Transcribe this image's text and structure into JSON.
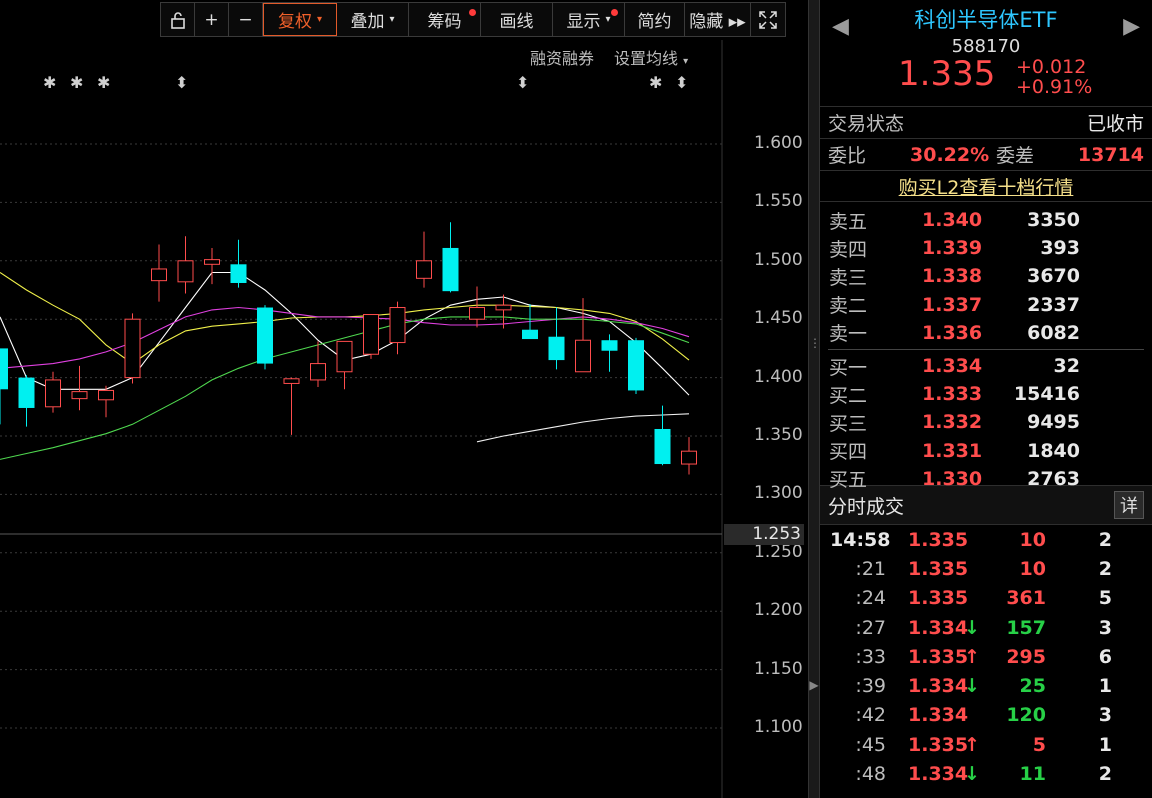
{
  "toolbar": {
    "items": [
      {
        "id": "lock",
        "label": "",
        "icon": "lock-icon"
      },
      {
        "id": "plus",
        "label": "+",
        "icon": "plus-icon"
      },
      {
        "id": "minus",
        "label": "−",
        "icon": "minus-icon"
      },
      {
        "id": "fuquan",
        "label": "复权",
        "active": true,
        "caret": true
      },
      {
        "id": "diejia",
        "label": "叠加",
        "caret": true
      },
      {
        "id": "chouma",
        "label": "筹码",
        "dot": true
      },
      {
        "id": "huaxian",
        "label": "画线"
      },
      {
        "id": "xianshi",
        "label": "显示",
        "caret": true,
        "dot": true
      },
      {
        "id": "jianyue",
        "label": "简约"
      },
      {
        "id": "yincang",
        "label": "隐藏 ▸▸"
      },
      {
        "id": "fullscreen",
        "label": "",
        "icon": "fullscreen-icon"
      }
    ]
  },
  "sub_tools": {
    "margin_label": "融资融券",
    "ma_label": "设置均线"
  },
  "markers": [
    "✱",
    "✱",
    "✱",
    "⬍",
    "⬍",
    "✱",
    "⬍"
  ],
  "chart_data": {
    "type": "candlestick",
    "y_ticks": [
      "1.600",
      "1.550",
      "1.500",
      "1.450",
      "1.400",
      "1.350",
      "1.300",
      "1.250",
      "1.200",
      "1.150",
      "1.100"
    ],
    "ylim": [
      1.08,
      1.64
    ],
    "current_price_tag": "1.253",
    "candles": [
      {
        "o": 1.39,
        "h": 1.395,
        "l": 1.36,
        "c": 1.425,
        "dir": "down"
      },
      {
        "o": 1.4,
        "h": 1.402,
        "l": 1.358,
        "c": 1.374,
        "dir": "down"
      },
      {
        "o": 1.375,
        "h": 1.405,
        "l": 1.37,
        "c": 1.398,
        "dir": "up"
      },
      {
        "o": 1.382,
        "h": 1.41,
        "l": 1.372,
        "c": 1.388,
        "dir": "up"
      },
      {
        "o": 1.381,
        "h": 1.393,
        "l": 1.366,
        "c": 1.389,
        "dir": "up"
      },
      {
        "o": 1.4,
        "h": 1.455,
        "l": 1.395,
        "c": 1.45,
        "dir": "up"
      },
      {
        "o": 1.483,
        "h": 1.514,
        "l": 1.465,
        "c": 1.493,
        "dir": "up"
      },
      {
        "o": 1.482,
        "h": 1.521,
        "l": 1.472,
        "c": 1.5,
        "dir": "up"
      },
      {
        "o": 1.497,
        "h": 1.511,
        "l": 1.48,
        "c": 1.501,
        "dir": "up"
      },
      {
        "o": 1.497,
        "h": 1.518,
        "l": 1.477,
        "c": 1.481,
        "dir": "down"
      },
      {
        "o": 1.46,
        "h": 1.462,
        "l": 1.407,
        "c": 1.412,
        "dir": "down"
      },
      {
        "o": 1.395,
        "h": 1.4,
        "l": 1.351,
        "c": 1.399,
        "dir": "up"
      },
      {
        "o": 1.398,
        "h": 1.431,
        "l": 1.392,
        "c": 1.412,
        "dir": "up"
      },
      {
        "o": 1.405,
        "h": 1.421,
        "l": 1.39,
        "c": 1.431,
        "dir": "up"
      },
      {
        "o": 1.42,
        "h": 1.454,
        "l": 1.416,
        "c": 1.454,
        "dir": "up"
      },
      {
        "o": 1.43,
        "h": 1.465,
        "l": 1.42,
        "c": 1.46,
        "dir": "up"
      },
      {
        "o": 1.485,
        "h": 1.525,
        "l": 1.477,
        "c": 1.5,
        "dir": "up"
      },
      {
        "o": 1.511,
        "h": 1.533,
        "l": 1.473,
        "c": 1.474,
        "dir": "down"
      },
      {
        "o": 1.45,
        "h": 1.478,
        "l": 1.443,
        "c": 1.46,
        "dir": "up"
      },
      {
        "o": 1.458,
        "h": 1.471,
        "l": 1.442,
        "c": 1.462,
        "dir": "up"
      },
      {
        "o": 1.441,
        "h": 1.463,
        "l": 1.433,
        "c": 1.433,
        "dir": "down"
      },
      {
        "o": 1.435,
        "h": 1.46,
        "l": 1.407,
        "c": 1.415,
        "dir": "down"
      },
      {
        "o": 1.405,
        "h": 1.468,
        "l": 1.405,
        "c": 1.432,
        "dir": "up"
      },
      {
        "o": 1.432,
        "h": 1.437,
        "l": 1.405,
        "c": 1.423,
        "dir": "down"
      },
      {
        "o": 1.432,
        "h": 1.434,
        "l": 1.386,
        "c": 1.389,
        "dir": "down"
      },
      {
        "o": 1.356,
        "h": 1.376,
        "l": 1.325,
        "c": 1.326,
        "dir": "down"
      },
      {
        "o": 1.326,
        "h": 1.349,
        "l": 1.317,
        "c": 1.337,
        "dir": "up"
      }
    ],
    "series": [
      {
        "color": "#ffffff",
        "y": [
          1.452,
          1.4,
          1.39,
          1.39,
          1.39,
          1.4,
          1.43,
          1.46,
          1.49,
          1.49,
          1.475,
          1.455,
          1.432,
          1.415,
          1.42,
          1.432,
          1.45,
          1.462,
          1.467,
          1.469,
          1.462,
          1.46,
          1.455,
          1.448,
          1.43,
          1.408,
          1.385
        ]
      },
      {
        "color": "#f0f04a",
        "y": [
          1.49,
          1.475,
          1.462,
          1.45,
          1.428,
          1.412,
          1.428,
          1.44,
          1.444,
          1.446,
          1.448,
          1.451,
          1.452,
          1.452,
          1.453,
          1.455,
          1.458,
          1.46,
          1.462,
          1.462,
          1.461,
          1.46,
          1.458,
          1.455,
          1.448,
          1.433,
          1.415
        ]
      },
      {
        "color": "#e040e0",
        "y": [
          1.408,
          1.41,
          1.412,
          1.416,
          1.422,
          1.43,
          1.441,
          1.452,
          1.458,
          1.46,
          1.458,
          1.455,
          1.452,
          1.452,
          1.451,
          1.45,
          1.447,
          1.445,
          1.445,
          1.446,
          1.448,
          1.45,
          1.452,
          1.45,
          1.447,
          1.442,
          1.435
        ]
      },
      {
        "color": "#4fd84f",
        "y": [
          1.33,
          1.335,
          1.34,
          1.346,
          1.352,
          1.36,
          1.372,
          1.384,
          1.398,
          1.408,
          1.416,
          1.422,
          1.428,
          1.434,
          1.44,
          1.446,
          1.45,
          1.452,
          1.452,
          1.452,
          1.45,
          1.45,
          1.45,
          1.448,
          1.446,
          1.438,
          1.43
        ]
      },
      {
        "color": "#f0f0f0",
        "y": [
          null,
          null,
          null,
          null,
          null,
          null,
          null,
          null,
          null,
          null,
          null,
          null,
          null,
          null,
          null,
          null,
          null,
          null,
          1.345,
          1.35,
          1.354,
          1.358,
          1.362,
          1.365,
          1.367,
          1.368,
          1.369
        ]
      }
    ]
  },
  "quote": {
    "name": "科创半导体ETF",
    "code": "588170",
    "price": "1.335",
    "change": "+0.012",
    "change_pct": "+0.91%"
  },
  "status": {
    "label": "交易状态",
    "value": "已收市"
  },
  "ratio": {
    "label1": "委比",
    "value1": "30.22%",
    "label2": "委差",
    "value2": "13714"
  },
  "l2_link": "购买L2查看十档行情",
  "asks": [
    {
      "label": "卖五",
      "price": "1.340",
      "vol": "3350"
    },
    {
      "label": "卖四",
      "price": "1.339",
      "vol": "393"
    },
    {
      "label": "卖三",
      "price": "1.338",
      "vol": "3670"
    },
    {
      "label": "卖二",
      "price": "1.337",
      "vol": "2337"
    },
    {
      "label": "卖一",
      "price": "1.336",
      "vol": "6082"
    }
  ],
  "bids": [
    {
      "label": "买一",
      "price": "1.334",
      "vol": "32"
    },
    {
      "label": "买二",
      "price": "1.333",
      "vol": "15416"
    },
    {
      "label": "买三",
      "price": "1.332",
      "vol": "9495"
    },
    {
      "label": "买四",
      "price": "1.331",
      "vol": "1840"
    },
    {
      "label": "买五",
      "price": "1.330",
      "vol": "2763"
    }
  ],
  "ticks_header": {
    "title": "分时成交",
    "detail": "详"
  },
  "ticks": [
    {
      "time": "14:58",
      "price": "1.335",
      "arrow": "",
      "vol": "10",
      "vol_color": "red",
      "count": "2"
    },
    {
      "time": ":21",
      "price": "1.335",
      "arrow": "",
      "vol": "10",
      "vol_color": "red",
      "count": "2"
    },
    {
      "time": ":24",
      "price": "1.335",
      "arrow": "",
      "vol": "361",
      "vol_color": "red",
      "count": "5"
    },
    {
      "time": ":27",
      "price": "1.334",
      "arrow": "↓",
      "vol": "157",
      "vol_color": "green",
      "count": "3"
    },
    {
      "time": ":33",
      "price": "1.335",
      "arrow": "↑",
      "vol": "295",
      "vol_color": "red",
      "count": "6"
    },
    {
      "time": ":39",
      "price": "1.334",
      "arrow": "↓",
      "vol": "25",
      "vol_color": "green",
      "count": "1"
    },
    {
      "time": ":42",
      "price": "1.334",
      "arrow": "",
      "vol": "120",
      "vol_color": "green",
      "count": "3"
    },
    {
      "time": ":45",
      "price": "1.335",
      "arrow": "↑",
      "vol": "5",
      "vol_color": "red",
      "count": "1"
    },
    {
      "time": ":48",
      "price": "1.334",
      "arrow": "↓",
      "vol": "11",
      "vol_color": "green",
      "count": "2"
    }
  ],
  "colors": {
    "up": "#ff4d4d",
    "down": "#00f0f0",
    "name": "#2ec7ff",
    "green": "#27d047"
  }
}
